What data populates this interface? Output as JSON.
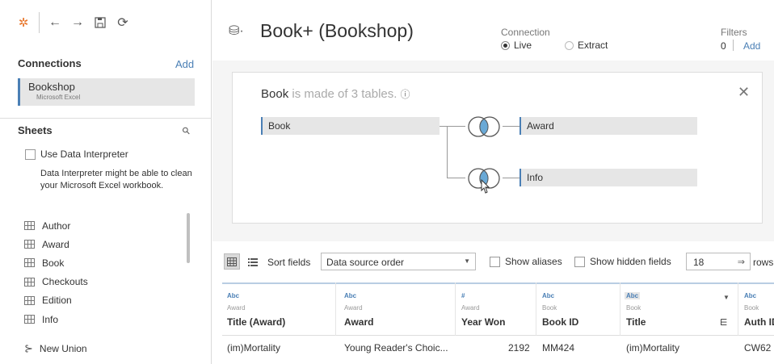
{
  "toolbar": {
    "logo_icon": "tableau-logo-icon",
    "back_icon": "back-arrow-icon",
    "forward_icon": "forward-arrow-icon",
    "save_icon": "save-icon",
    "refresh_icon": "refresh-icon"
  },
  "sidebar": {
    "connections_title": "Connections",
    "connections_add": "Add",
    "connection": {
      "name": "Bookshop",
      "type": "Microsoft Excel"
    },
    "sheets_title": "Sheets",
    "use_interpreter_label": "Use Data Interpreter",
    "interpreter_desc": "Data Interpreter might be able to clean your Microsoft Excel workbook.",
    "sheets": [
      {
        "label": "Author"
      },
      {
        "label": "Award"
      },
      {
        "label": "Book"
      },
      {
        "label": "Checkouts"
      },
      {
        "label": "Edition"
      },
      {
        "label": "Info"
      }
    ],
    "new_union_label": "New Union"
  },
  "header": {
    "title": "Book+ (Bookshop)",
    "connection_label": "Connection",
    "live_label": "Live",
    "extract_label": "Extract",
    "connection_selected": "Live",
    "filters_label": "Filters",
    "filters_count": "0",
    "filters_add": "Add"
  },
  "relationship": {
    "title_table": "Book",
    "title_suffix": " is made of 3 tables.",
    "root_table": "Book",
    "related_tables": [
      {
        "label": "Award"
      },
      {
        "label": "Info"
      }
    ]
  },
  "grid_toolbar": {
    "sort_label": "Sort fields",
    "sort_value": "Data source order",
    "show_aliases": "Show aliases",
    "show_hidden": "Show hidden fields",
    "rows_value": "18",
    "rows_label": "rows"
  },
  "grid": {
    "columns": [
      {
        "type": "Abc",
        "source": "Award",
        "name": "Title (Award)",
        "value": "(im)Mortality"
      },
      {
        "type": "Abc",
        "source": "Award",
        "name": "Award",
        "value": "Young Reader's Choic..."
      },
      {
        "type": "#",
        "source": "Award",
        "name": "Year Won",
        "value": "2192"
      },
      {
        "type": "Abc",
        "source": "Book",
        "name": "Book ID",
        "value": "MM424"
      },
      {
        "type": "Abc",
        "source": "Book",
        "name": "Title",
        "value": "(im)Mortality"
      },
      {
        "type": "Abc",
        "source": "Book",
        "name": "Auth ID",
        "value": "CW62"
      }
    ]
  },
  "colors": {
    "accent": "#4a7fb5",
    "venn_fill": "#6aa9d6",
    "canvas_bg": "#f5f5f5",
    "table_bg": "#e6e6e6"
  }
}
